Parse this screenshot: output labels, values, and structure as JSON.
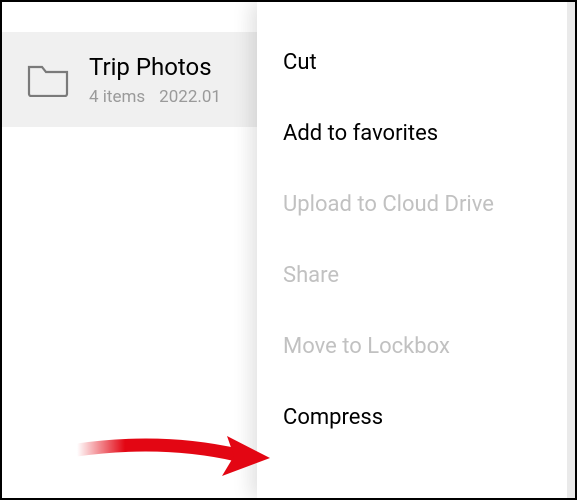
{
  "folder": {
    "name": "Trip Photos",
    "items_count": "4 items",
    "date": "2022.01"
  },
  "menu": {
    "cut": "Cut",
    "add_favorites": "Add to favorites",
    "upload_cloud": "Upload to Cloud Drive",
    "share": "Share",
    "move_lockbox": "Move to Lockbox",
    "compress": "Compress"
  },
  "annotation": {
    "arrow_color": "#e30613"
  }
}
